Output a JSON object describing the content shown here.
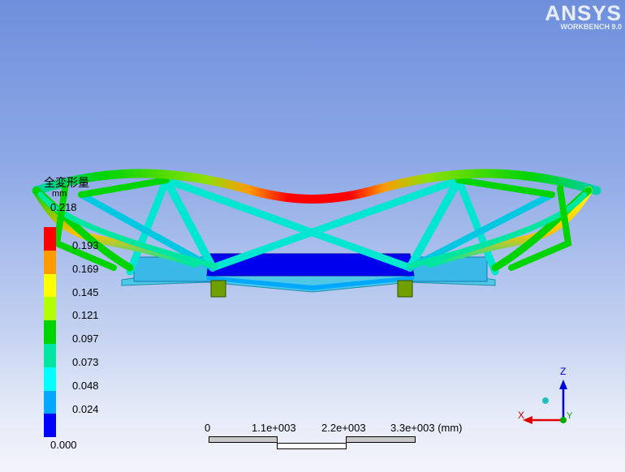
{
  "logo": {
    "brand": "ANSYS",
    "sub": "WORKBENCH 9.0"
  },
  "legend": {
    "title": "全変形量",
    "unit": "mm",
    "max": "0.218",
    "levels": [
      "0.193",
      "0.169",
      "0.145",
      "0.121",
      "0.097",
      "0.073",
      "0.048",
      "0.024"
    ],
    "min": "0.000",
    "colors": [
      "#ff0000",
      "#ff9a00",
      "#ffff00",
      "#b2ff00",
      "#00d400",
      "#00e6a0",
      "#00ffff",
      "#00a8ff",
      "#0000ff"
    ]
  },
  "scale": {
    "ticks": [
      "0",
      "1.1e+003",
      "2.2e+003",
      "3.3e+003 (mm)"
    ]
  },
  "triad": {
    "z": "Z",
    "x": "X",
    "y": "Y"
  }
}
